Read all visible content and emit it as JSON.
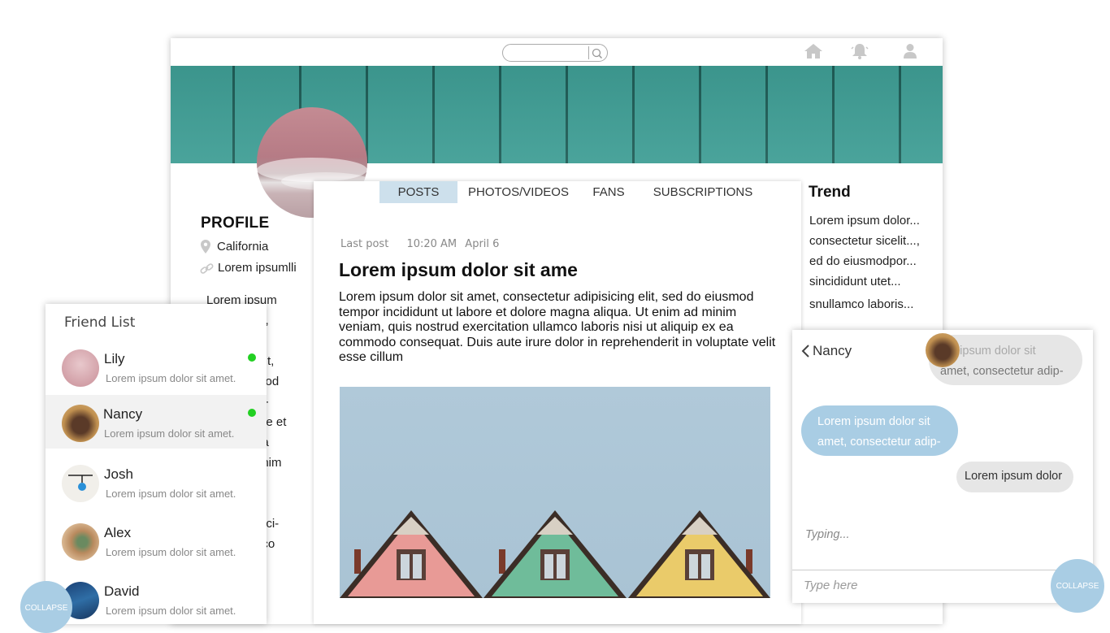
{
  "header": {
    "search": {
      "value": "",
      "placeholder": ""
    },
    "icons": [
      "search-icon",
      "home-icon",
      "bell-icon",
      "user-icon"
    ]
  },
  "profile": {
    "title": "PROFILE",
    "location": "California",
    "link": "Lorem ipsumlli",
    "bio_lines": [
      "Lorem ipsum",
      "et,",
      "r",
      "elit,",
      "mod",
      "di-",
      "ore et",
      "na",
      "enim",
      "",
      "is",
      "erci-",
      "nco"
    ]
  },
  "tabs": [
    {
      "label": "POSTS",
      "active": true
    },
    {
      "label": "PHOTOS/VIDEOS",
      "active": false
    },
    {
      "label": "FANS",
      "active": false
    },
    {
      "label": "SUBSCRIPTIONS",
      "active": false
    }
  ],
  "post": {
    "meta_label": "Last post",
    "time": "10:20 AM",
    "date": "April 6",
    "title": "Lorem ipsum dolor sit ame",
    "body": "Lorem ipsum dolor sit amet, consectetur adipisicing elit, sed do eiusmod tempor incididunt ut labore et dolore magna aliqua. Ut enim ad minim veniam, quis nostrud exercitation ullamco laboris nisi ut aliquip ex ea commodo consequat. Duis aute irure dolor in reprehenderit in voluptate velit esse cillum"
  },
  "trend": {
    "title": "Trend",
    "items": [
      "Lorem ipsum dolor...",
      "consectetur sicelit...,",
      "ed do eiusmodpor...",
      "sincididunt utet...",
      "snullamco laboris..."
    ]
  },
  "friend_list": {
    "title": "Friend List",
    "friends": [
      {
        "name": "Lily",
        "message": "Lorem ipsum dolor sit amet.",
        "online": true
      },
      {
        "name": "Nancy",
        "message": "Lorem ipsum dolor sit amet.",
        "online": true
      },
      {
        "name": "Josh",
        "message": "Lorem ipsum dolor sit amet.",
        "online": false
      },
      {
        "name": "Alex",
        "message": "Lorem ipsum dolor sit amet.",
        "online": false
      },
      {
        "name": "David",
        "message": "Lorem ipsum dolor sit amet.",
        "online": false
      }
    ],
    "collapse_label": "COLLAPSE"
  },
  "chat": {
    "name": "Nancy",
    "messages": [
      {
        "text_line1": "em ipsum dolor sit",
        "text_line2": "amet, consectetur adip-"
      },
      {
        "text_line1": "Lorem ipsum dolor sit",
        "text_line2": "amet, consectetur adip-"
      },
      {
        "text_line1": "Lorem ipsum dolor",
        "text_line2": ""
      }
    ],
    "typing": "Typing...",
    "input_placeholder": "Type here",
    "collapse_label": "COLLAPSE"
  },
  "colors": {
    "accent": "#a9cde4",
    "banner": "#3f9e95",
    "online": "#22d022",
    "active_tab": "#cde0ec"
  }
}
